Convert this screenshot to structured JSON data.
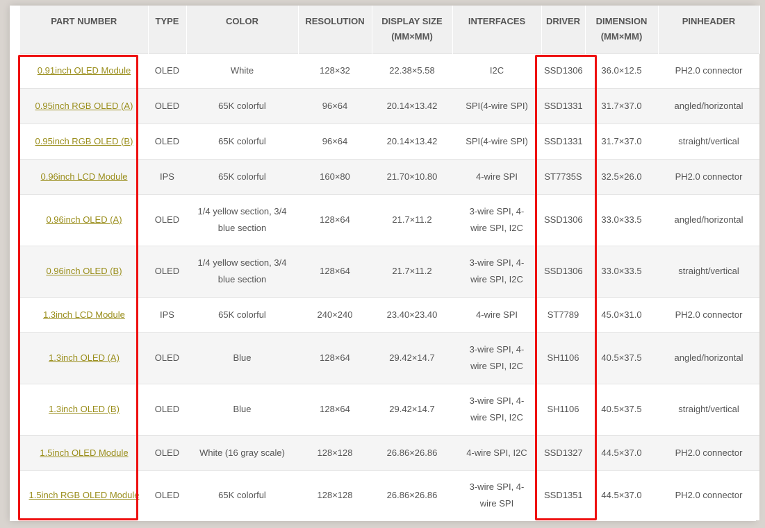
{
  "table": {
    "headers": [
      [
        "PART NUMBER"
      ],
      [
        "TYPE"
      ],
      [
        "COLOR"
      ],
      [
        "RESOLUTION"
      ],
      [
        "DISPLAY SIZE",
        "(MM×MM)"
      ],
      [
        "INTERFACES"
      ],
      [
        "DRIVER"
      ],
      [
        "DIMENSION",
        "(MM×MM)"
      ],
      [
        "PINHEADER"
      ]
    ],
    "rows": [
      {
        "part": "0.91inch OLED Module",
        "type": "OLED",
        "color": [
          "White"
        ],
        "resolution": "128×32",
        "display_size": "22.38×5.58",
        "interfaces": [
          "I2C"
        ],
        "driver": "SSD1306",
        "dimension": "36.0×12.5",
        "pinheader": "PH2.0 connector"
      },
      {
        "part": "0.95inch RGB OLED (A)",
        "type": "OLED",
        "color": [
          "65K colorful"
        ],
        "resolution": "96×64",
        "display_size": "20.14×13.42",
        "interfaces": [
          "SPI(4-wire SPI)"
        ],
        "driver": "SSD1331",
        "dimension": "31.7×37.0",
        "pinheader": "angled/horizontal"
      },
      {
        "part": "0.95inch RGB OLED (B)",
        "type": "OLED",
        "color": [
          "65K colorful"
        ],
        "resolution": "96×64",
        "display_size": "20.14×13.42",
        "interfaces": [
          "SPI(4-wire SPI)"
        ],
        "driver": "SSD1331",
        "dimension": "31.7×37.0",
        "pinheader": "straight/vertical"
      },
      {
        "part": "0.96inch LCD Module",
        "type": "IPS",
        "color": [
          "65K colorful"
        ],
        "resolution": "160×80",
        "display_size": "21.70×10.80",
        "interfaces": [
          "4-wire SPI"
        ],
        "driver": "ST7735S",
        "dimension": "32.5×26.0",
        "pinheader": "PH2.0 connector"
      },
      {
        "part": "0.96inch OLED (A)",
        "type": "OLED",
        "color": [
          "1/4 yellow section, 3/4",
          "blue section"
        ],
        "resolution": "128×64",
        "display_size": "21.7×11.2",
        "interfaces": [
          "3-wire SPI, 4-",
          "wire SPI, I2C"
        ],
        "driver": "SSD1306",
        "dimension": "33.0×33.5",
        "pinheader": "angled/horizontal"
      },
      {
        "part": "0.96inch OLED (B)",
        "type": "OLED",
        "color": [
          "1/4 yellow section, 3/4",
          "blue section"
        ],
        "resolution": "128×64",
        "display_size": "21.7×11.2",
        "interfaces": [
          "3-wire SPI, 4-",
          "wire SPI, I2C"
        ],
        "driver": "SSD1306",
        "dimension": "33.0×33.5",
        "pinheader": "straight/vertical"
      },
      {
        "part": "1.3inch LCD Module",
        "type": "IPS",
        "color": [
          "65K colorful"
        ],
        "resolution": "240×240",
        "display_size": "23.40×23.40",
        "interfaces": [
          "4-wire SPI"
        ],
        "driver": "ST7789",
        "dimension": "45.0×31.0",
        "pinheader": "PH2.0 connector"
      },
      {
        "part": "1.3inch OLED (A)",
        "type": "OLED",
        "color": [
          "Blue"
        ],
        "resolution": "128×64",
        "display_size": "29.42×14.7",
        "interfaces": [
          "3-wire SPI, 4-",
          "wire SPI, I2C"
        ],
        "driver": "SH1106",
        "dimension": "40.5×37.5",
        "pinheader": "angled/horizontal"
      },
      {
        "part": "1.3inch OLED (B)",
        "type": "OLED",
        "color": [
          "Blue"
        ],
        "resolution": "128×64",
        "display_size": "29.42×14.7",
        "interfaces": [
          "3-wire SPI, 4-",
          "wire SPI, I2C"
        ],
        "driver": "SH1106",
        "dimension": "40.5×37.5",
        "pinheader": "straight/vertical"
      },
      {
        "part": "1.5inch OLED Module",
        "type": "OLED",
        "color": [
          "White (16 gray scale)"
        ],
        "resolution": "128×128",
        "display_size": "26.86×26.86",
        "interfaces": [
          "4-wire SPI, I2C"
        ],
        "driver": "SSD1327",
        "dimension": "44.5×37.0",
        "pinheader": "PH2.0 connector"
      },
      {
        "part": "1.5inch RGB OLED Module",
        "type": "OLED",
        "color": [
          "65K colorful"
        ],
        "resolution": "128×128",
        "display_size": "26.86×26.86",
        "interfaces": [
          "3-wire SPI, 4-",
          "wire SPI"
        ],
        "driver": "SSD1351",
        "dimension": "44.5×37.0",
        "pinheader": "PH2.0 connector"
      }
    ]
  },
  "colors": {
    "link": "#9a8e1c",
    "highlight": "#ee1111",
    "header_bg": "#f0f0f0",
    "alt_row_bg": "#f5f5f5"
  }
}
